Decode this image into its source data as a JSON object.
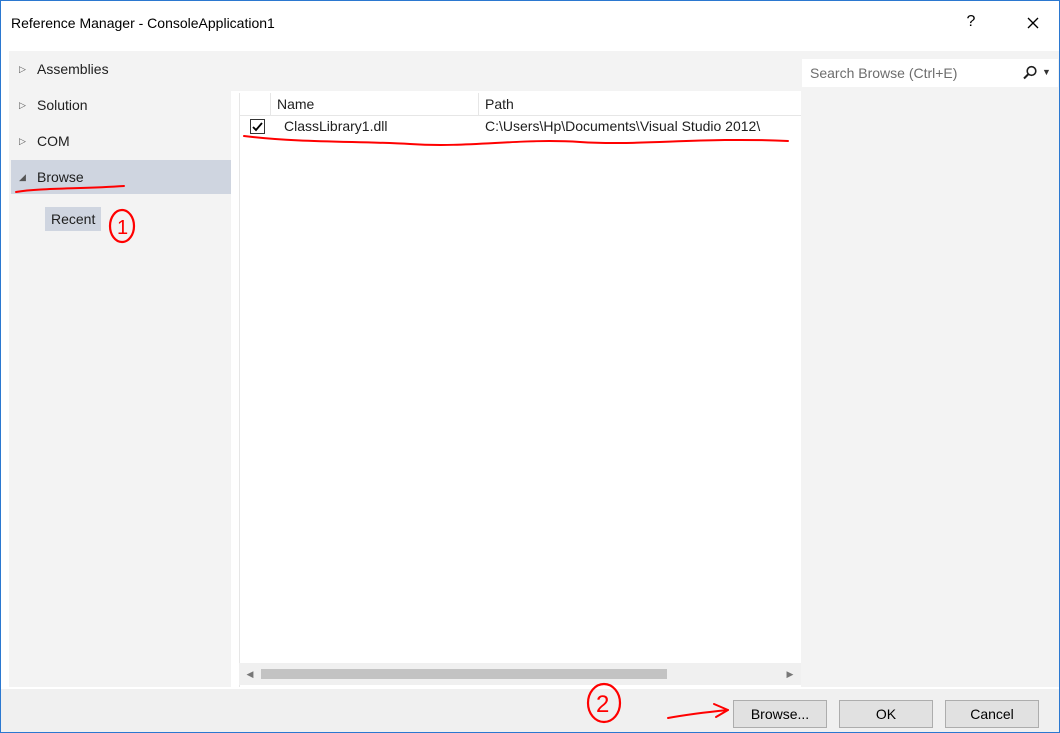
{
  "window": {
    "title": "Reference Manager - ConsoleApplication1",
    "help_glyph": "?"
  },
  "sidebar": {
    "items": [
      {
        "label": "Assemblies",
        "expanded": false
      },
      {
        "label": "Solution",
        "expanded": false
      },
      {
        "label": "COM",
        "expanded": false
      },
      {
        "label": "Browse",
        "expanded": true,
        "selected": true
      }
    ],
    "subitems": [
      {
        "label": "Recent",
        "selected": true
      }
    ]
  },
  "search": {
    "placeholder": "Search Browse (Ctrl+E)"
  },
  "list": {
    "columns": [
      "Name",
      "Path"
    ],
    "rows": [
      {
        "checked": true,
        "name": "ClassLibrary1.dll",
        "path": "C:\\Users\\Hp\\Documents\\Visual Studio 2012\\"
      }
    ]
  },
  "buttons": {
    "browse": "Browse...",
    "ok": "OK",
    "cancel": "Cancel"
  },
  "annotations": {
    "marker_1": "1",
    "marker_2": "2",
    "color": "#ff0000"
  },
  "colors": {
    "selection": "#cfd5e0",
    "window_border": "#2b78d0"
  }
}
